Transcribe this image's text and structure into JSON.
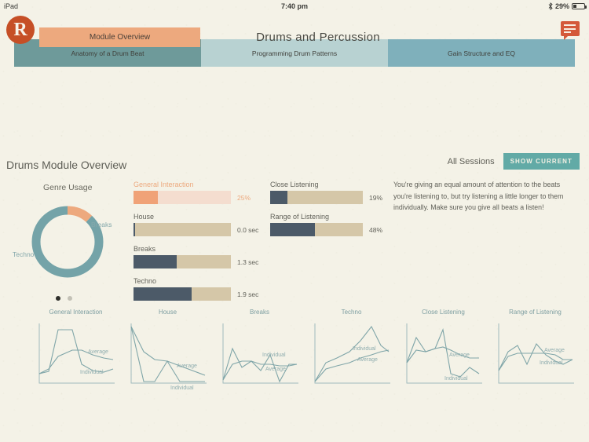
{
  "statusbar": {
    "device": "iPad",
    "time": "7:40 pm",
    "battery_pct": "29%",
    "bluetooth_icon": "bluetooth-icon",
    "battery_icon": "battery-icon"
  },
  "header": {
    "logo_letter": "R",
    "module_button": "Module Overview",
    "title": "Drums and Percussion",
    "chat_icon": "chat-bubble-icon"
  },
  "tabs": [
    {
      "label": "Anatomy of a Drum Beat",
      "color": "#6e9a9a",
      "selected": true
    },
    {
      "label": "Programming Drum Patterns",
      "color": "#b8d2d2",
      "selected": false
    },
    {
      "label": "Gain Structure and EQ",
      "color": "#7fb0bb",
      "selected": false
    }
  ],
  "overview": {
    "section_title": "Drums Module Overview",
    "genre_usage_label": "Genre Usage",
    "pager": {
      "active_index": 0,
      "count": 2
    }
  },
  "sessions": {
    "label": "All Sessions",
    "show_current_button": "SHOW CURRENT"
  },
  "advice": {
    "text": "You're giving an equal amount of attention to the beats you're listening to, but try listening a little longer to them individually. Make sure you give all beats a listen!"
  },
  "colors": {
    "background": "#f4f2e7",
    "orange": "#eda97e",
    "orange_dark": "#c64f26",
    "teal": "#6e9a9a",
    "teal_light": "#b8d2d2",
    "teal_mid": "#7fb0bb",
    "teal_button": "#62aaa6",
    "slate": "#4c5a68",
    "tan": "#d5c7a8",
    "peach": "#f4ddcf",
    "chart_line": "#8fadaf"
  },
  "chart_data": [
    {
      "type": "pie",
      "title": "Genre Usage",
      "labels": [
        "Breaks",
        "Techno"
      ],
      "values": [
        12,
        88
      ],
      "colors": [
        "#eda97e",
        "#6e9a9a"
      ],
      "legend": "inline-labels",
      "donut": true
    },
    {
      "type": "bar",
      "title": "Left metrics",
      "orientation": "horizontal",
      "categories": [
        "General Interaction",
        "House",
        "Breaks",
        "Techno"
      ],
      "values": [
        25,
        0,
        44,
        60
      ],
      "value_labels": [
        "25%",
        "0.0 sec",
        "1.3 sec",
        "1.9 sec"
      ],
      "track_colors": [
        "#f4ddcf",
        "#d5c7a8",
        "#d5c7a8",
        "#d5c7a8"
      ],
      "fill_colors": [
        "#f0a277",
        "#4c5a68",
        "#4c5a68",
        "#4c5a68"
      ],
      "label_accent": [
        true,
        false,
        false,
        false
      ],
      "xlim": [
        0,
        100
      ]
    },
    {
      "type": "bar",
      "title": "Right metrics",
      "orientation": "horizontal",
      "categories": [
        "Close Listening",
        "Range of Listening"
      ],
      "values": [
        19,
        48
      ],
      "value_labels": [
        "19%",
        "48%"
      ],
      "track_colors": [
        "#d5c7a8",
        "#d5c7a8"
      ],
      "fill_colors": [
        "#4c5a68",
        "#4c5a68"
      ],
      "label_accent": [
        false,
        false
      ],
      "xlim": [
        0,
        100
      ]
    },
    {
      "type": "line",
      "title": "General Interaction",
      "series": [
        {
          "name": "Individual",
          "values": [
            8,
            10,
            62,
            62,
            26,
            14,
            12,
            16
          ]
        },
        {
          "name": "Average",
          "values": [
            8,
            14,
            30,
            42,
            42,
            36,
            32,
            30
          ]
        }
      ],
      "legend": [
        "Average",
        "Individual"
      ]
    },
    {
      "type": "line",
      "title": "House",
      "series": [
        {
          "name": "Individual",
          "values": [
            60,
            2,
            2,
            28,
            2,
            2,
            2,
            2
          ]
        },
        {
          "name": "Average",
          "values": [
            60,
            36,
            26,
            24,
            28,
            20,
            14,
            10
          ]
        }
      ],
      "legend": [
        "Average",
        "Individual"
      ]
    },
    {
      "type": "line",
      "title": "Breaks",
      "series": [
        {
          "name": "Individual",
          "values": [
            4,
            38,
            14,
            20,
            12,
            28,
            2,
            20,
            20
          ]
        },
        {
          "name": "Average",
          "values": [
            4,
            18,
            20,
            20,
            18,
            18,
            16,
            16,
            18
          ]
        }
      ],
      "legend": [
        "Individual",
        "Average"
      ]
    },
    {
      "type": "line",
      "title": "Techno",
      "series": [
        {
          "name": "Individual",
          "values": [
            2,
            20,
            26,
            34,
            48,
            66,
            46,
            40
          ]
        },
        {
          "name": "Average",
          "values": [
            2,
            14,
            18,
            22,
            26,
            30,
            34,
            36
          ]
        }
      ],
      "legend": [
        "Individual",
        "Average"
      ]
    },
    {
      "type": "line",
      "title": "Close Listening",
      "series": [
        {
          "name": "Individual",
          "values": [
            26,
            52,
            34,
            58,
            38,
            8,
            6,
            14,
            10
          ]
        },
        {
          "name": "Average",
          "values": [
            26,
            38,
            34,
            40,
            36,
            32,
            28,
            26,
            26
          ]
        }
      ],
      "legend": [
        "Average",
        "Individual"
      ]
    },
    {
      "type": "line",
      "title": "Range of Listening",
      "series": [
        {
          "name": "Individual",
          "values": [
            14,
            34,
            42,
            24,
            42,
            28,
            22,
            20,
            24
          ]
        },
        {
          "name": "Average",
          "values": [
            14,
            28,
            32,
            32,
            32,
            32,
            30,
            24,
            24
          ]
        }
      ],
      "legend": [
        "Average",
        "Individual"
      ]
    }
  ]
}
